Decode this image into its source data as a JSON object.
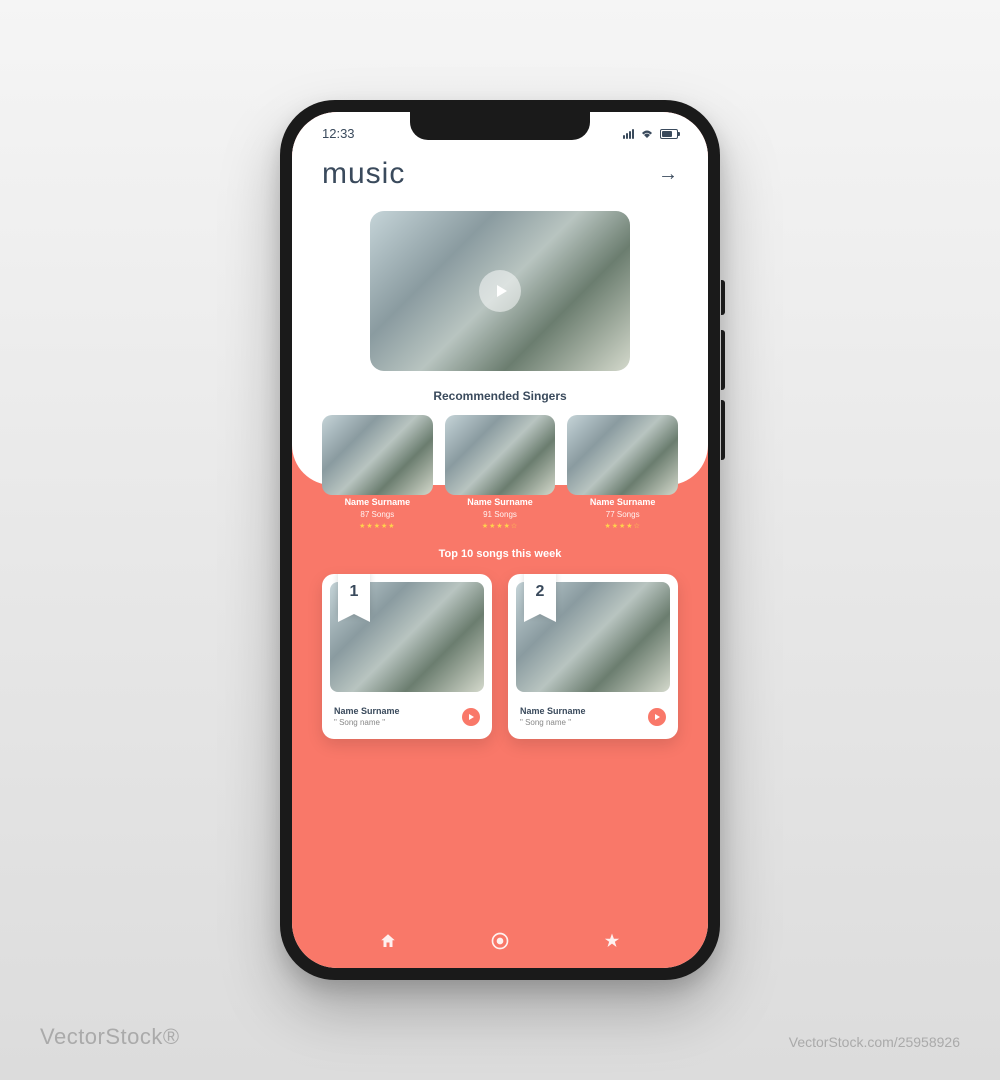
{
  "status": {
    "time": "12:33"
  },
  "header": {
    "title": "music"
  },
  "sections": {
    "recommended_title": "Recommended Singers",
    "top_songs_title": "Top 10 songs this week"
  },
  "singers": [
    {
      "name": "Name Surname",
      "songs": "87 Songs",
      "stars": "★★★★★"
    },
    {
      "name": "Name Surname",
      "songs": "91 Songs",
      "stars": "★★★★☆"
    },
    {
      "name": "Name Surname",
      "songs": "77 Songs",
      "stars": "★★★★☆"
    }
  ],
  "top_songs": [
    {
      "rank": "1",
      "artist": "Name Surname",
      "title": "\" Song name \""
    },
    {
      "rank": "2",
      "artist": "Name Surname",
      "title": "\" Song name \""
    }
  ],
  "watermark": {
    "brand": "VectorStock®",
    "id": "VectorStock.com/25958926"
  }
}
